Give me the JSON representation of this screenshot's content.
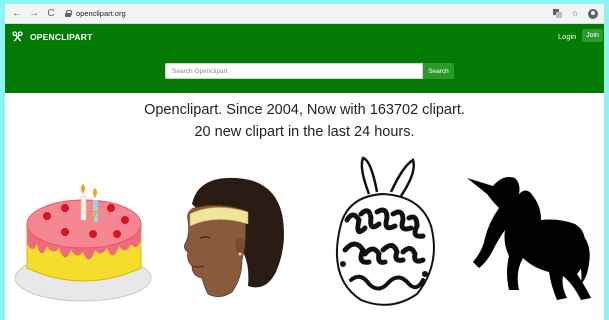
{
  "browser": {
    "url": "openclipart.org",
    "nav_back": "←",
    "nav_forward": "→",
    "nav_reload": "C",
    "translate_icon": "translate-icon",
    "star_icon": "star-icon",
    "profile_icon": "profile-icon"
  },
  "header": {
    "logo_text": "OPENCLIPART",
    "login_label": "Login",
    "join_label": "Join",
    "search_placeholder": "Search Openclipart",
    "search_button_label": "Search",
    "brand_color": "#037b03"
  },
  "main": {
    "headline_line1": "Openclipart. Since 2004, Now with 163702 clipart.",
    "headline_line2": "20 new clipart in the last 24 hours."
  },
  "gallery": [
    {
      "name": "birthday-cake",
      "icon": "cake-icon"
    },
    {
      "name": "woman-head",
      "icon": "portrait-icon"
    },
    {
      "name": "happy-easter",
      "icon": "easter-egg-icon"
    },
    {
      "name": "unicorn",
      "icon": "unicorn-icon"
    }
  ]
}
